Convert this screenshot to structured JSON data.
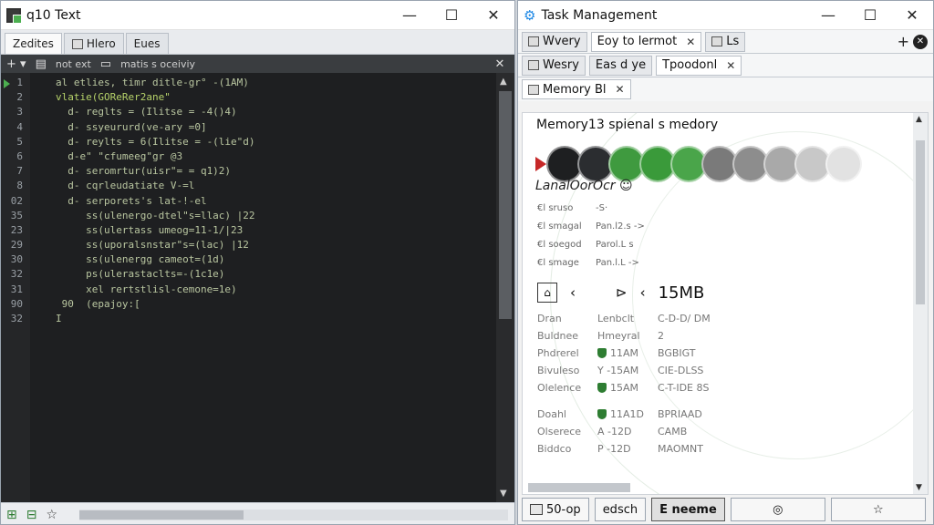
{
  "left_window": {
    "title": "q10 Text",
    "controls": [
      "—",
      "☐",
      "✕"
    ],
    "tabs": [
      "Zedites",
      "Hlero",
      "Eues"
    ],
    "toolbar": {
      "item1": "not ext",
      "item2": "matis s oceiviy"
    },
    "line_numbers": [
      "1",
      "2",
      "3",
      "4",
      "5",
      "6",
      "7",
      "8",
      "02",
      "35",
      "23",
      "29",
      "30",
      "32",
      "31",
      "90",
      "32"
    ],
    "code_lines": [
      "al etlies, timr ditle-gr° -(1AM)",
      "vlatie(GOReRer2ane\"",
      "  d- reglts = (Ilitse = -4()4)",
      "  d- ssyeururd(ve-ary =0]",
      "  d- reylts = 6(Ilitse = -(lie\"d)",
      "  d-e\" \"cfumeeg\"gr @3",
      "  d- seromrtur(uisr\"= = q1)2)",
      "  d- cqrleudatiate V-=l",
      "  d- serporets's lat-!-el",
      "     ss(ulenergo-dtel\"s=llac) |22",
      "     ss(ulertass umeog=11-1/|23",
      "     ss(uporalsnstar\"s=(lac) |12",
      "     ss(ulenergg cameot=(1d)",
      "     ps(ulerastaclts=-(1c1e)",
      "     xel rertstlisl-cemone=1e)",
      " 90  (epajoy:[",
      "I"
    ]
  },
  "right_window": {
    "title": "Task Management",
    "controls": [
      "—",
      "☐",
      "✕"
    ],
    "tabs_row1": [
      "Wvery",
      "Eoy to lermot",
      "Ls"
    ],
    "tabs_row2": [
      "Wesry",
      "Eas d ye",
      "Tpoodonl"
    ],
    "tabs_row3": [
      "Memory Bl"
    ],
    "panel": {
      "title": "Memory13 spienal s medory",
      "dot_colors": [
        "#1e1f21",
        "#2b2d30",
        "#3f9a3f",
        "#3a9a3a",
        "#4aa54a",
        "#7a7a7a",
        "#8d8d8d",
        "#a9a9a9",
        "#c8c8c8",
        "#e2e2e2"
      ],
      "legend_title": "LanalOorOcr",
      "mini_rows": [
        {
          "a": "€l sruso",
          "b": "-S·"
        },
        {
          "a": "€l smagal",
          "b": "Pan.l2.s ->"
        },
        {
          "a": "€l soegod",
          "b": "Parol.L s"
        },
        {
          "a": "€l smage",
          "b": "Pan.l.L ->"
        }
      ],
      "memory_head": {
        "icon_left": "⌂",
        "arrow_left": "‹",
        "icon_right": "⊳",
        "arrow_right": "‹",
        "value": "15MB"
      },
      "stats_block1": [
        {
          "c1": "Dran",
          "c2": "Lenbclt",
          "c3": "C-D-D/ DM",
          "shield": false
        },
        {
          "c1": "Buldnee",
          "c2": "Hmeyral",
          "c3": "2",
          "shield": false
        },
        {
          "c1": "Phdrerel",
          "c2": "11AM",
          "c3": "BGBIGT",
          "shield": true
        },
        {
          "c1": "Bivuleso",
          "c2": "Y -15AM",
          "c3": "CIE-DLSS",
          "shield": false
        },
        {
          "c1": "Olelence",
          "c2": "15AM",
          "c3": "C-T-IDE 8S",
          "shield": true
        }
      ],
      "stats_block2": [
        {
          "c1": "Doahl",
          "c2": "11A1D",
          "c3": "BPRIAAD",
          "shield": true
        },
        {
          "c1": "Olserece",
          "c2": "A -12D",
          "c3": "CAMB",
          "shield": false
        },
        {
          "c1": "Biddco",
          "c2": "P -12D",
          "c3": "MAOMNT",
          "shield": false
        }
      ]
    },
    "bottom_buttons": [
      "50-op",
      "edsch",
      "E neeme",
      "◎",
      "☆"
    ]
  }
}
